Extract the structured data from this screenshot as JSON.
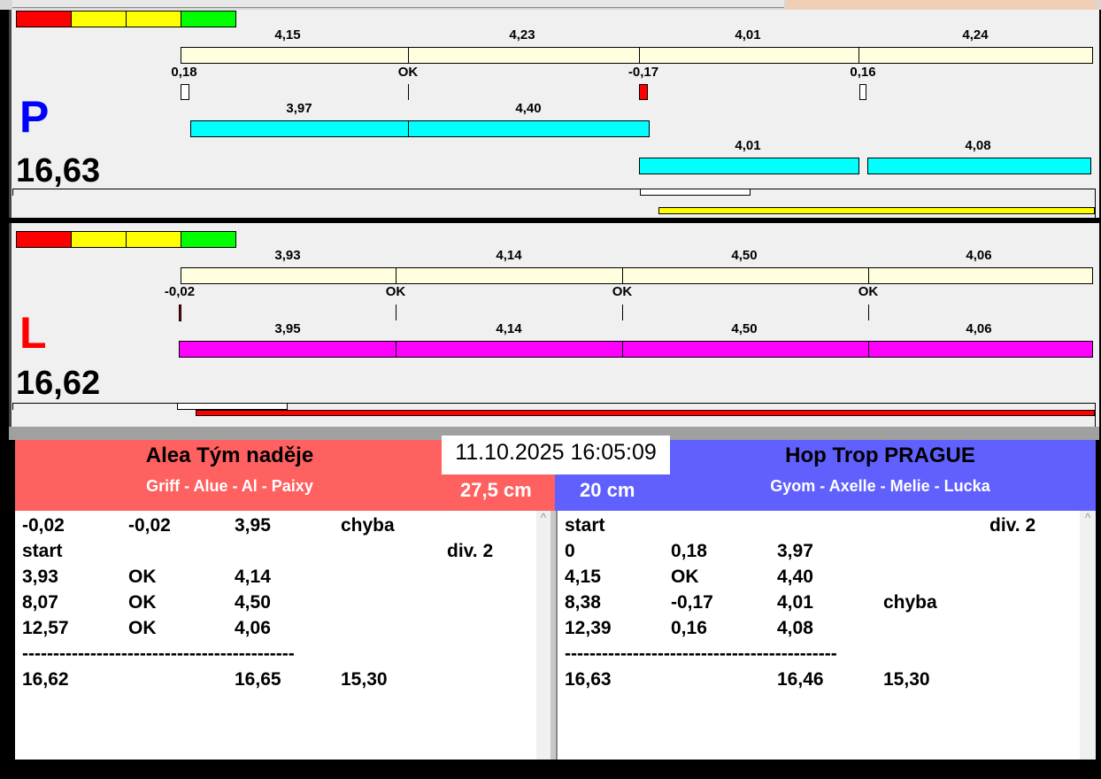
{
  "colors": {
    "red": "#ff0000",
    "yellow": "#ffff00",
    "green": "#00ff00",
    "beige": "#ffffe0",
    "cyan": "#00ffff",
    "magenta": "#ff00ff",
    "team_left": "#ff6060",
    "team_right": "#6060ff"
  },
  "P": {
    "letter": "P",
    "total": "16,63",
    "top_labels": [
      "4,15",
      "4,23",
      "4,01",
      "4,24"
    ],
    "diff_labels": [
      "0,18",
      "OK",
      "-0,17",
      "0,16"
    ],
    "row1_labels": [
      "3,97",
      "4,40"
    ],
    "row2_labels": [
      "4,01",
      "4,08"
    ]
  },
  "L": {
    "letter": "L",
    "total": "16,62",
    "top_labels": [
      "3,93",
      "4,14",
      "4,50",
      "4,06"
    ],
    "diff_labels": [
      "-0,02",
      "OK",
      "OK",
      "OK"
    ],
    "row_labels": [
      "3,95",
      "4,14",
      "4,50",
      "4,06"
    ]
  },
  "datetime": "11.10.2025 16:05:09",
  "left_team": {
    "name": "Alea Tým naděje",
    "members": "Griff - Alue - Al - Paixy",
    "height": "27,5 cm",
    "rows": [
      [
        "-0,02",
        "-0,02",
        "3,95",
        "chyba",
        ""
      ],
      [
        "start",
        "",
        "",
        "",
        "div.  2"
      ],
      [
        "3,93",
        "OK",
        "4,14",
        "",
        ""
      ],
      [
        "8,07",
        "OK",
        "4,50",
        "",
        ""
      ],
      [
        "12,57",
        "OK",
        "4,06",
        "",
        ""
      ],
      [
        "--------------------------------------------",
        "",
        "",
        "",
        ""
      ],
      [
        "16,62",
        "",
        "16,65",
        "15,30",
        ""
      ]
    ]
  },
  "right_team": {
    "name": "Hop Trop PRAGUE",
    "members": "Gyom - Axelle - Melie - Lucka",
    "height": "20 cm",
    "rows": [
      [
        "start",
        "",
        "",
        "",
        "div.  2"
      ],
      [
        "0",
        "0,18",
        "3,97",
        "",
        ""
      ],
      [
        "4,15",
        "OK",
        "4,40",
        "",
        ""
      ],
      [
        "8,38",
        "-0,17",
        "4,01",
        "chyba",
        ""
      ],
      [
        "12,39",
        "0,16",
        "4,08",
        "",
        ""
      ],
      [
        "--------------------------------------------",
        "",
        "",
        "",
        ""
      ],
      [
        "16,63",
        "",
        "16,46",
        "15,30",
        ""
      ]
    ]
  }
}
